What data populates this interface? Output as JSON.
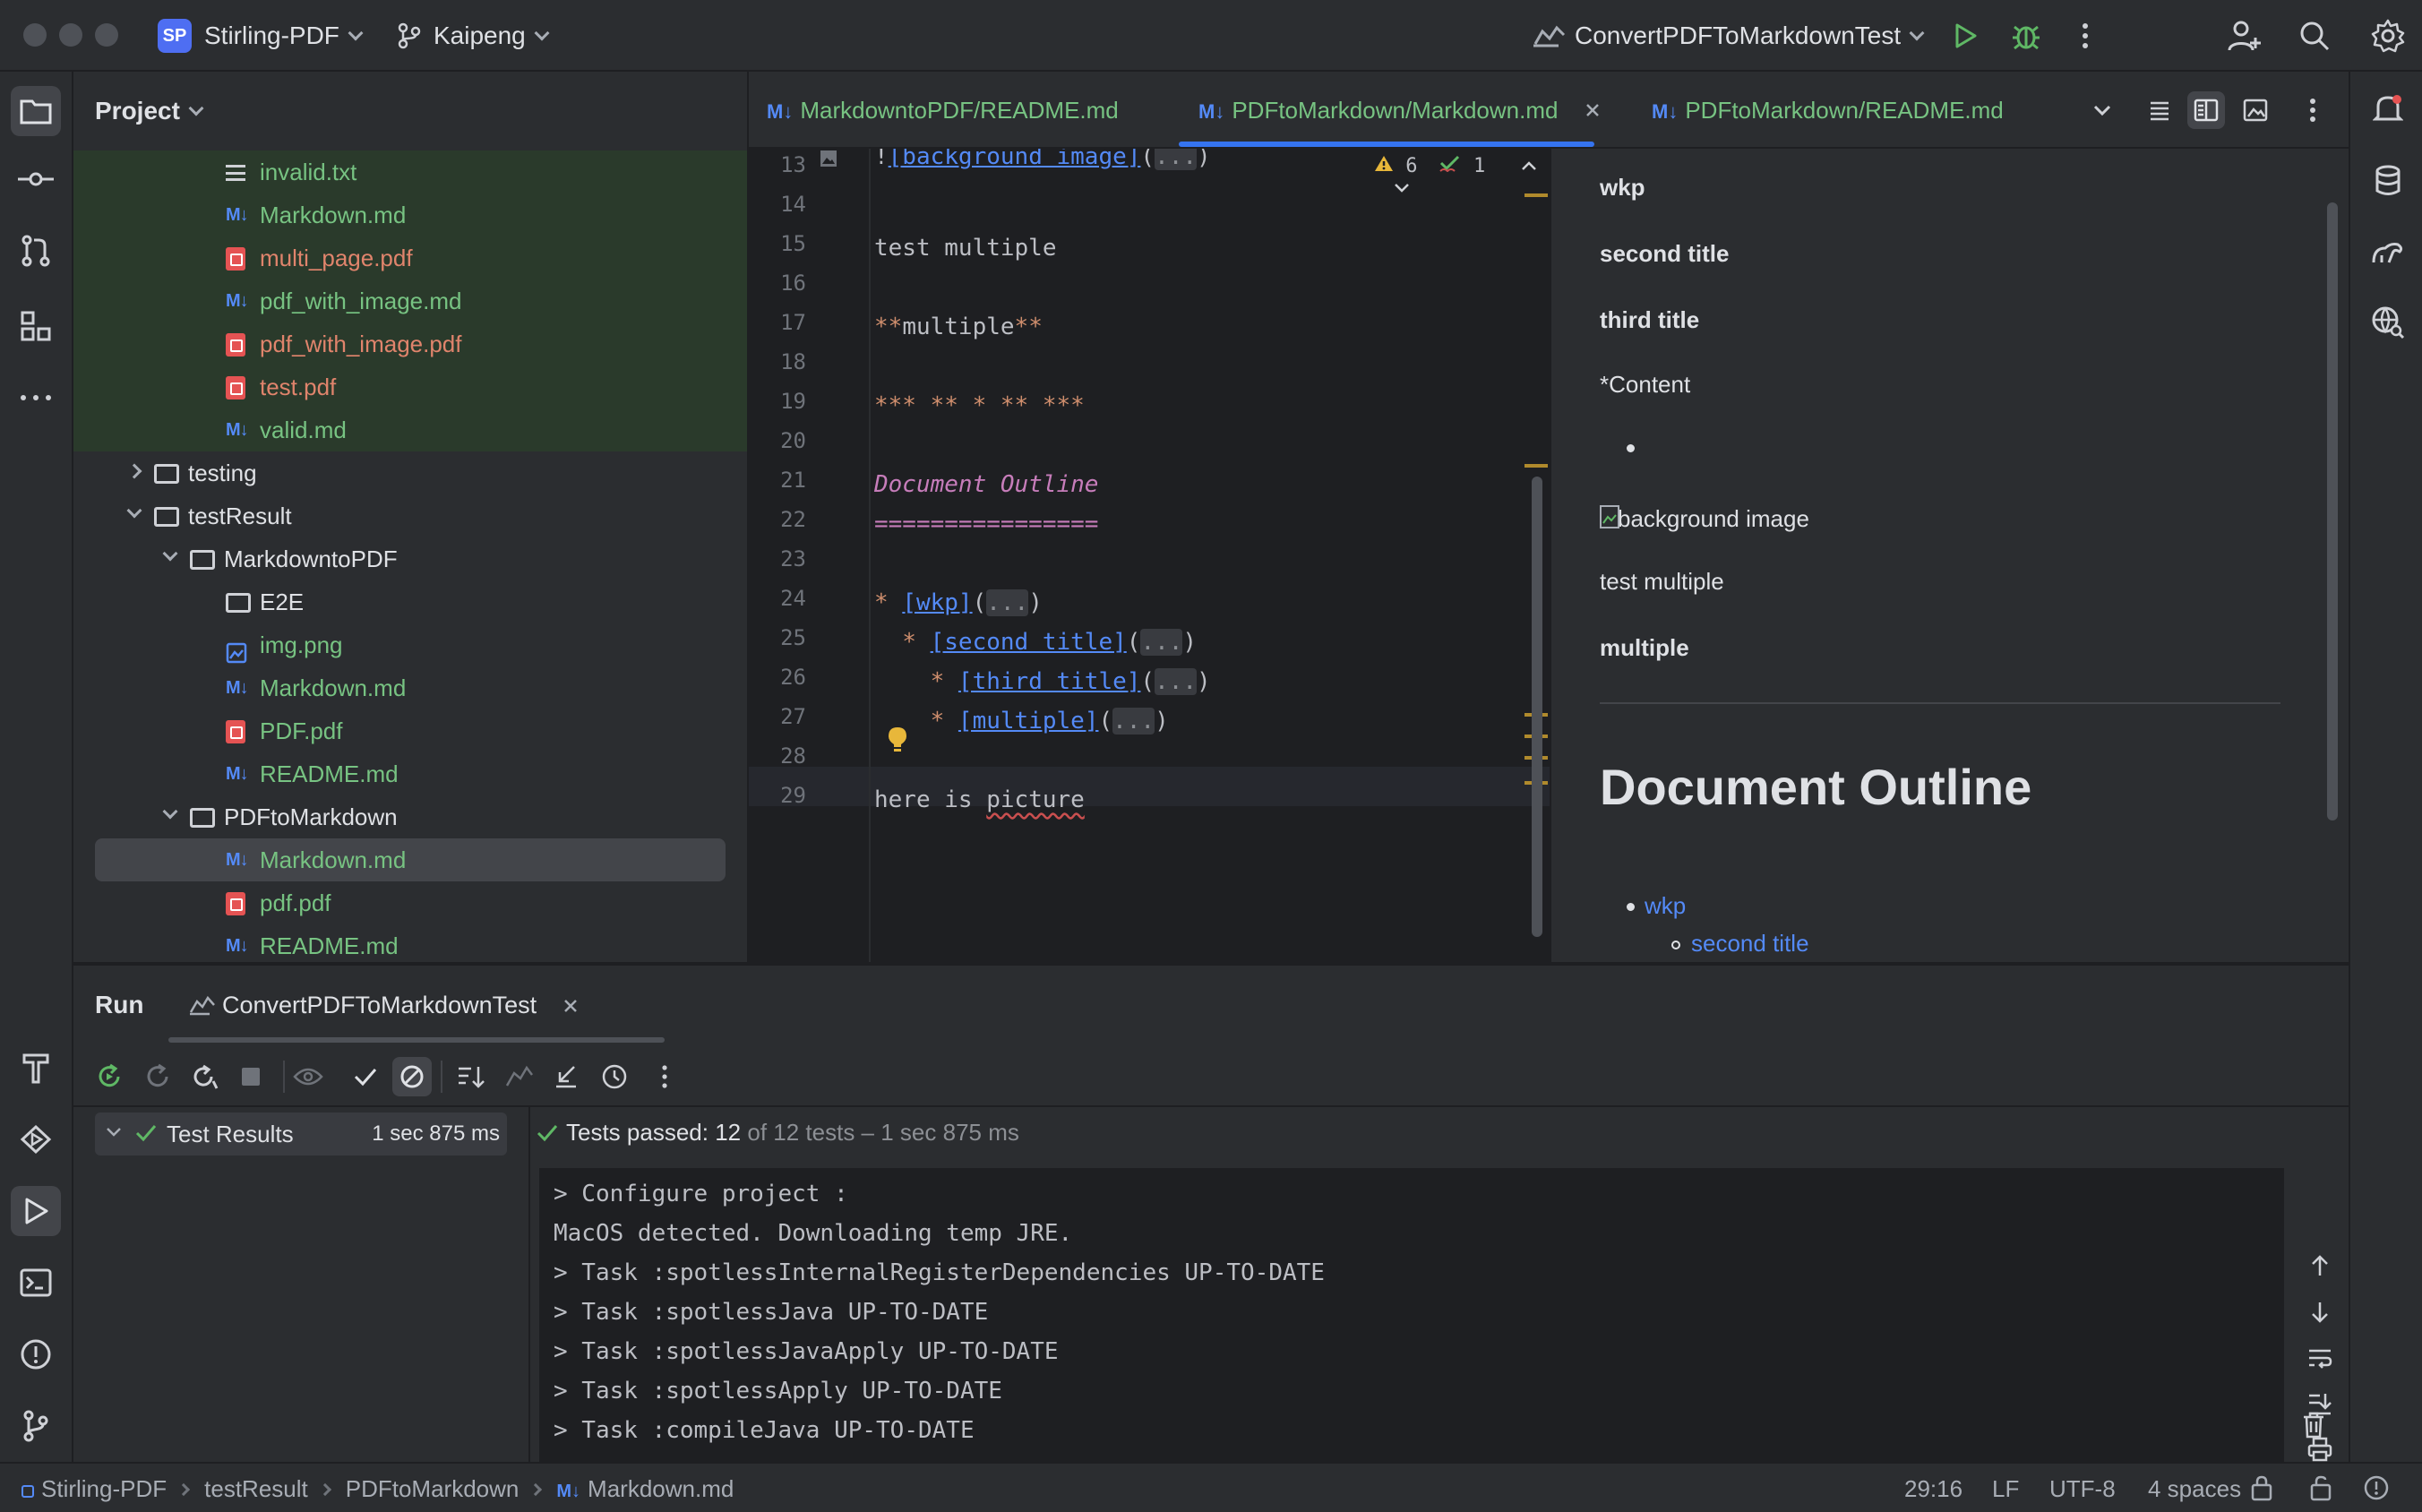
{
  "titlebar": {
    "project_badge": "SP",
    "project_name": "Stirling-PDF",
    "branch": "Kaipeng",
    "run_config": "ConvertPDFToMarkdownTest"
  },
  "project_panel": {
    "title": "Project",
    "tree": [
      {
        "label": "invalid.txt",
        "icon": "text-file-icon",
        "color": "green",
        "indent": 3
      },
      {
        "label": "Markdown.md",
        "icon": "markdown-file-icon",
        "color": "green",
        "indent": 3
      },
      {
        "label": "multi_page.pdf",
        "icon": "pdf-file-icon",
        "color": "red",
        "indent": 3
      },
      {
        "label": "pdf_with_image.md",
        "icon": "markdown-file-icon",
        "color": "green",
        "indent": 3
      },
      {
        "label": "pdf_with_image.pdf",
        "icon": "pdf-file-icon",
        "color": "red",
        "indent": 3
      },
      {
        "label": "test.pdf",
        "icon": "pdf-file-icon",
        "color": "red",
        "indent": 3
      },
      {
        "label": "valid.md",
        "icon": "markdown-file-icon",
        "color": "green",
        "indent": 3
      },
      {
        "label": "testing",
        "icon": "folder-icon",
        "color": "normal",
        "indent": 1,
        "arrow": "right"
      },
      {
        "label": "testResult",
        "icon": "folder-icon",
        "color": "normal",
        "indent": 1,
        "arrow": "down"
      },
      {
        "label": "MarkdowntoPDF",
        "icon": "folder-icon",
        "color": "normal",
        "indent": 2,
        "arrow": "down"
      },
      {
        "label": "E2E",
        "icon": "folder-icon",
        "color": "normal",
        "indent": 3
      },
      {
        "label": "img.png",
        "icon": "image-file-icon",
        "color": "green",
        "indent": 3
      },
      {
        "label": "Markdown.md",
        "icon": "markdown-file-icon",
        "color": "green",
        "indent": 3
      },
      {
        "label": "PDF.pdf",
        "icon": "pdf-file-icon",
        "color": "green",
        "indent": 3
      },
      {
        "label": "README.md",
        "icon": "markdown-file-icon",
        "color": "green",
        "indent": 3
      },
      {
        "label": "PDFtoMarkdown",
        "icon": "folder-icon",
        "color": "normal",
        "indent": 2,
        "arrow": "down"
      },
      {
        "label": "Markdown.md",
        "icon": "markdown-file-icon",
        "color": "green",
        "indent": 3,
        "selected": true
      },
      {
        "label": "pdf.pdf",
        "icon": "pdf-file-icon",
        "color": "green",
        "indent": 3
      },
      {
        "label": "README.md",
        "icon": "markdown-file-icon",
        "color": "green",
        "indent": 3
      }
    ]
  },
  "tabs": [
    {
      "label": "MarkdowntoPDF/README.md",
      "active": false
    },
    {
      "label": "PDFtoMarkdown/Markdown.md",
      "active": true
    },
    {
      "label": "PDFtoMarkdown/README.md",
      "active": false
    }
  ],
  "editor": {
    "inspections_warnings": "6",
    "inspections_ok": "1",
    "lines": [
      {
        "n": "13"
      },
      {
        "n": "14"
      },
      {
        "n": "15"
      },
      {
        "n": "16"
      },
      {
        "n": "17"
      },
      {
        "n": "18"
      },
      {
        "n": "19"
      },
      {
        "n": "20"
      },
      {
        "n": "21"
      },
      {
        "n": "22"
      },
      {
        "n": "23"
      },
      {
        "n": "24"
      },
      {
        "n": "25"
      },
      {
        "n": "26"
      },
      {
        "n": "27"
      },
      {
        "n": "28"
      },
      {
        "n": "29"
      }
    ],
    "code": {
      "l13_link": "[background image]",
      "l13_dots": "...",
      "l15": "test multiple",
      "l17_marks": "**",
      "l17_text": "multiple",
      "l19": "*** ** * ** ***",
      "l21": "Document Outline",
      "l22": "================",
      "l24_link": "[wkp]",
      "l25_link": "[second title]",
      "l26_link": "[third title]",
      "l27_link": "[multiple]",
      "l29": "here is picture"
    }
  },
  "preview": {
    "p1": "wkp",
    "p2": "second title",
    "p3": "third title",
    "p4": "*Content",
    "img_alt": "background image",
    "p5": "test multiple",
    "p6": "multiple",
    "h1": "Document Outline",
    "list_1": "wkp",
    "list_2": "second title"
  },
  "run_panel": {
    "tab_run": "Run",
    "tab_config": "ConvertPDFToMarkdownTest",
    "results_root": "Test Results",
    "results_time": "1 sec 875 ms",
    "summary_prefix": "Tests passed:",
    "summary_count": "12",
    "summary_rest": "of 12 tests – 1 sec 875 ms",
    "console_lines": [
      "> Configure project :",
      "MacOS detected. Downloading temp JRE.",
      "> Task :spotlessInternalRegisterDependencies UP-TO-DATE",
      "> Task :spotlessJava UP-TO-DATE",
      "> Task :spotlessJavaApply UP-TO-DATE",
      "> Task :spotlessApply UP-TO-DATE",
      "> Task :compileJava UP-TO-DATE"
    ]
  },
  "statusbar": {
    "breadcrumb": [
      "Stirling-PDF",
      "testResult",
      "PDFtoMarkdown",
      "Markdown.md"
    ],
    "position": "29:16",
    "line_sep": "LF",
    "encoding": "UTF-8",
    "indent": "4 spaces"
  },
  "colors": {
    "accent": "#3574f0",
    "green_file": "#77c382",
    "red_file": "#e0846c",
    "markdown_icon": "#548af7"
  }
}
